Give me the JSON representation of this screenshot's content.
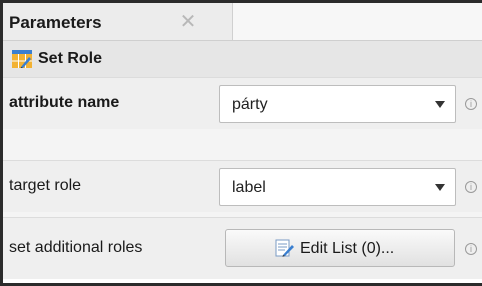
{
  "tab": {
    "title": "Parameters",
    "close_glyph": "✕"
  },
  "operator": {
    "title": "Set Role",
    "icon": "set-role-icon"
  },
  "params": {
    "attribute_name": {
      "label": "attribute name",
      "value": "párty"
    },
    "target_role": {
      "label": "target role",
      "value": "label"
    },
    "additional_roles": {
      "label": "set additional roles",
      "button_label": "Edit List (0)..."
    }
  },
  "info_glyph": "i"
}
